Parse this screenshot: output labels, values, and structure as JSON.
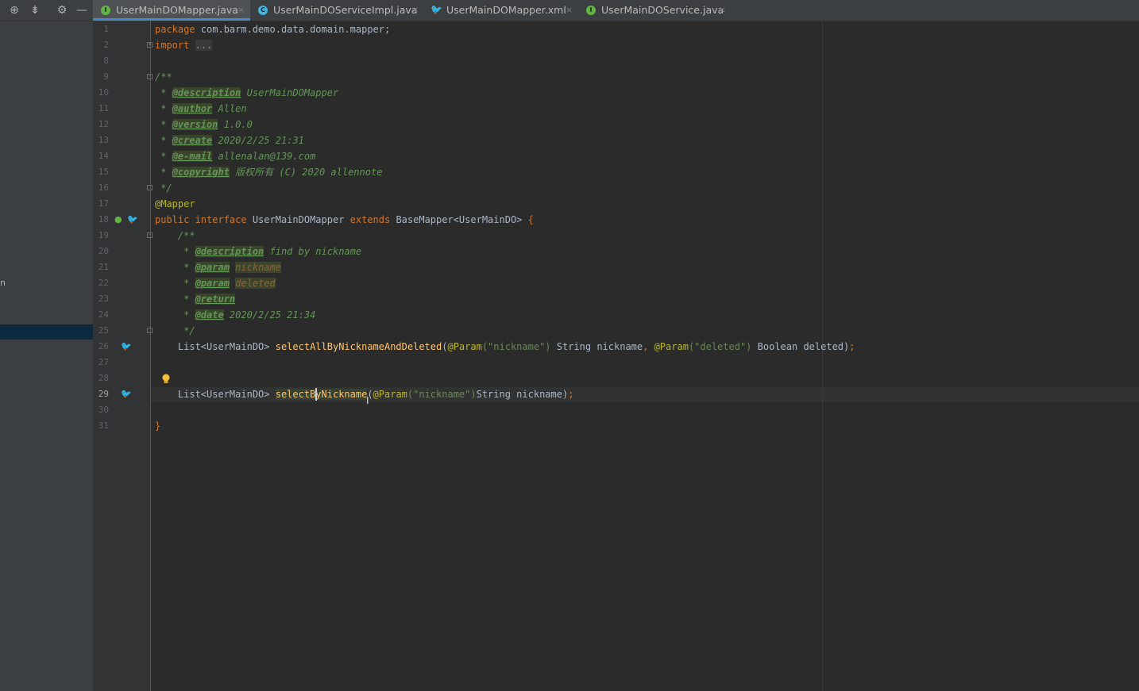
{
  "tabs": [
    {
      "label": "UserMainDOMapper.java",
      "icon": "I",
      "active": true
    },
    {
      "label": "UserMainDOServiceImpl.java",
      "icon": "C",
      "active": false
    },
    {
      "label": "UserMainDOMapper.xml",
      "icon": "mybatis-bird",
      "active": false
    },
    {
      "label": "UserMainDOService.java",
      "icon": "I",
      "active": false
    }
  ],
  "tab_close": "×",
  "panel": {
    "toolbar_icons": [
      "target-icon",
      "collapse-icon",
      "gear-icon",
      "minimize-icon"
    ],
    "edge_char": "n"
  },
  "line_numbers": [
    "1",
    "2",
    "8",
    "9",
    "10",
    "11",
    "12",
    "13",
    "14",
    "15",
    "16",
    "17",
    "18",
    "19",
    "20",
    "21",
    "22",
    "23",
    "24",
    "25",
    "26",
    "27",
    "28",
    "29",
    "30",
    "31"
  ],
  "current_line": "29",
  "code": {
    "l1_kw": "package",
    "l1_rest": " com.barm.demo.data.domain.mapper;",
    "l2_kw": "import",
    "l2_fold": "...",
    "l9": "/**",
    "star": " * ",
    "l10_tag": "@description",
    "l10_val": " UserMainDOMapper",
    "l11_tag": "@author",
    "l11_val": " Allen",
    "l12_tag": "@version",
    "l12_val": " 1.0.0",
    "l13_tag": "@create",
    "l13_val": " 2020/2/25 21:31",
    "l14_tag": "@e-mail",
    "l14_val": " allenalan@139.com",
    "l15_tag": "@copyright",
    "l15_val": " 版权所有 (C) 2020 allennote",
    "l16": " */",
    "l17": "@Mapper",
    "l18_kw1": "public interface ",
    "l18_name": "UserMainDOMapper ",
    "l18_kw2": "extends ",
    "l18_rest": "BaseMapper<UserMainDO> ",
    "l18_brace": "{",
    "l19": "    /**",
    "star2": "     * ",
    "l20_tag": "@description",
    "l20_val": " find by nickname",
    "l21_tag": "@param",
    "l21_val": "nickname",
    "l22_tag": "@param",
    "l22_val": "deleted",
    "l23_tag": "@return",
    "l24_tag": "@date",
    "l24_val": " 2020/2/25 21:34",
    "l25": "     */",
    "l26_type": "    List<UserMainDO> ",
    "l26_meth": "selectAllByNicknameAndDeleted",
    "l26_p1": "(",
    "l26_ann1": "@Param",
    "l26_s1": "(\"nickname\")",
    "l26_mid": " String nickname",
    "l26_comma": ", ",
    "l26_ann2": "@Param",
    "l26_s2": "(\"deleted\")",
    "l26_end": " Boolean deleted)",
    "semi": ";",
    "l29_type": "    List<UserMainDO> ",
    "l29_meth": "selectByNickname",
    "l29_p1": "(",
    "l29_ann": "@Param",
    "l29_s": "(\"nickname\")",
    "l29_end": "String nickname)",
    "l31": "}"
  }
}
